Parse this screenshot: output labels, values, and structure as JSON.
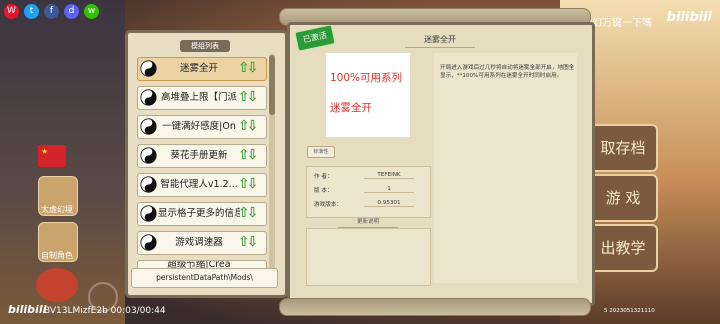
{
  "top_bar": {
    "social_icons": [
      "weibo-icon",
      "twitter-icon",
      "facebook-icon",
      "discord-icon",
      "wechat-icon"
    ],
    "hint": "要神幻万键一下嗎",
    "brand": "bilibili"
  },
  "left_side": {
    "flag": "china-flag",
    "buttons": [
      {
        "label": "太虚幻境"
      },
      {
        "label": "自制角色"
      }
    ]
  },
  "right_menu": {
    "items": [
      {
        "label": "取存档"
      },
      {
        "label": "游 戏"
      },
      {
        "label": "出教学"
      }
    ]
  },
  "mod_list": {
    "title": "模组列表",
    "items": [
      {
        "label": "迷雾全开",
        "active": true
      },
      {
        "label": "高堆叠上限【门派",
        "active": false
      },
      {
        "label": "一键满好感度|On",
        "active": false
      },
      {
        "label": "葵花手册更新",
        "active": false
      },
      {
        "label": "智能代理人v1.2...",
        "active": false
      },
      {
        "label": "显示格子更多的信息",
        "active": false
      },
      {
        "label": "游戏调速器",
        "active": false
      },
      {
        "label": "超级节缩|Crea",
        "active": false
      }
    ],
    "path_button": "persistentDataPath\\Mods\\"
  },
  "detail": {
    "badge": "已激活",
    "title": "迷雾全开",
    "preview_line1": "100%可用系列",
    "preview_line2": "迷雾全开",
    "description": "开局进入游戏后过几秒将自动将迷雾全部开启，地图全显示，**100%可用系列在迷雾全开时同时启用。",
    "tag": "标准性",
    "meta": {
      "author_key": "作 者：",
      "author_val": "TEFEINK",
      "version_key": "版 本：",
      "version_val": "1",
      "game_version_key": "游戏版本：",
      "game_version_val": "0.95301"
    },
    "notes_label": "更新说明"
  },
  "bottom": {
    "brand": "bilibili",
    "uid": "BV13LMizfE2b 00:03/00:44",
    "version": "5 2023051321110"
  },
  "colors": {
    "panel_bg": "#e6dcc0",
    "panel_border": "#7a6a58",
    "active_item": "#ead3a2",
    "badge_green": "#2d9a3a",
    "preview_red": "#e0302a"
  }
}
